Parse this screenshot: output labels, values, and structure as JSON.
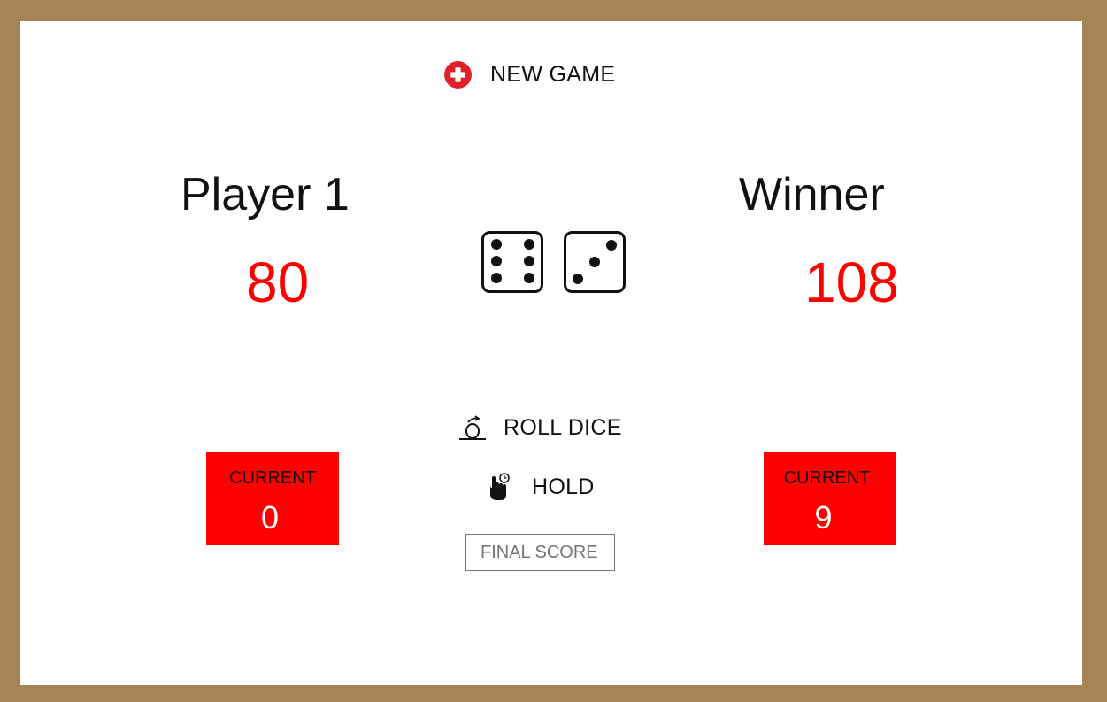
{
  "controls": {
    "new_game_label": "NEW GAME",
    "roll_dice_label": "ROLL DICE",
    "hold_label": "HOLD",
    "final_score_placeholder": "FINAL SCORE"
  },
  "players": [
    {
      "name": "Player 1",
      "score": "80",
      "current_label": "CURRENT",
      "current": "0"
    },
    {
      "name": "Winner",
      "score": "108",
      "current_label": "CURRENT",
      "current": "9"
    }
  ],
  "dice": [
    6,
    3
  ],
  "colors": {
    "frame": "#a88455",
    "score": "#ff0000",
    "current_box": "#ff0000",
    "new_game_icon": "#e0202a"
  }
}
